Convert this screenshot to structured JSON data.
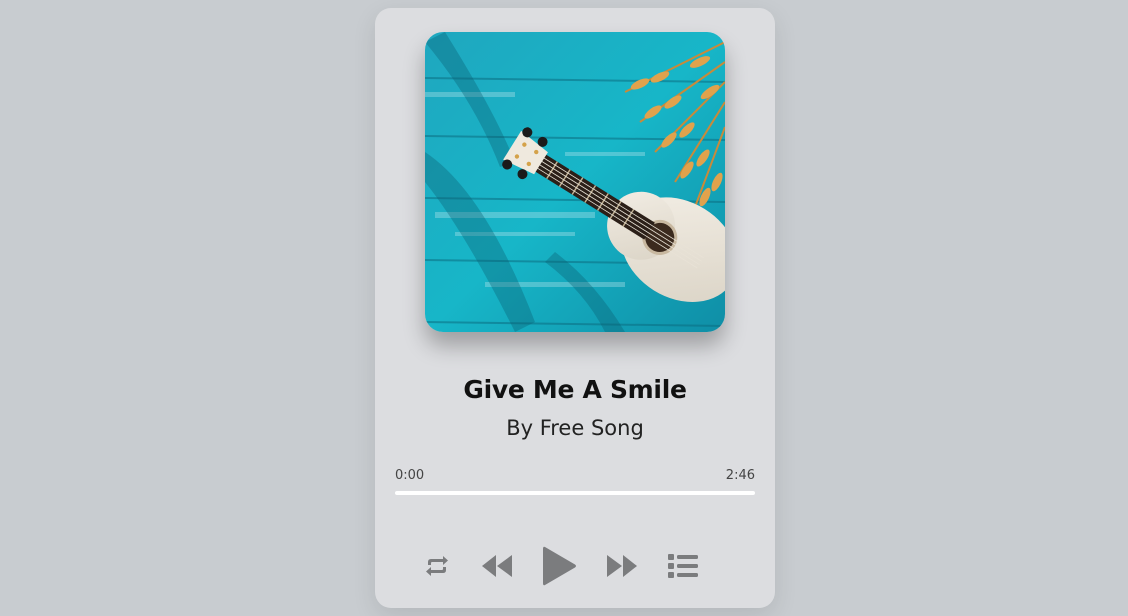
{
  "track": {
    "title": "Give Me A Smile",
    "artist": "By Free Song"
  },
  "player": {
    "current_time": "0:00",
    "duration": "2:46",
    "progress": 0
  },
  "controls": {
    "repeat_icon": "repeat-icon",
    "previous_icon": "rewind-icon",
    "play_icon": "play-icon",
    "next_icon": "fast-forward-icon",
    "playlist_icon": "playlist-icon",
    "icon_color": "#7b7c7e"
  },
  "cover": {
    "icon": "album-cover-ukulele"
  }
}
